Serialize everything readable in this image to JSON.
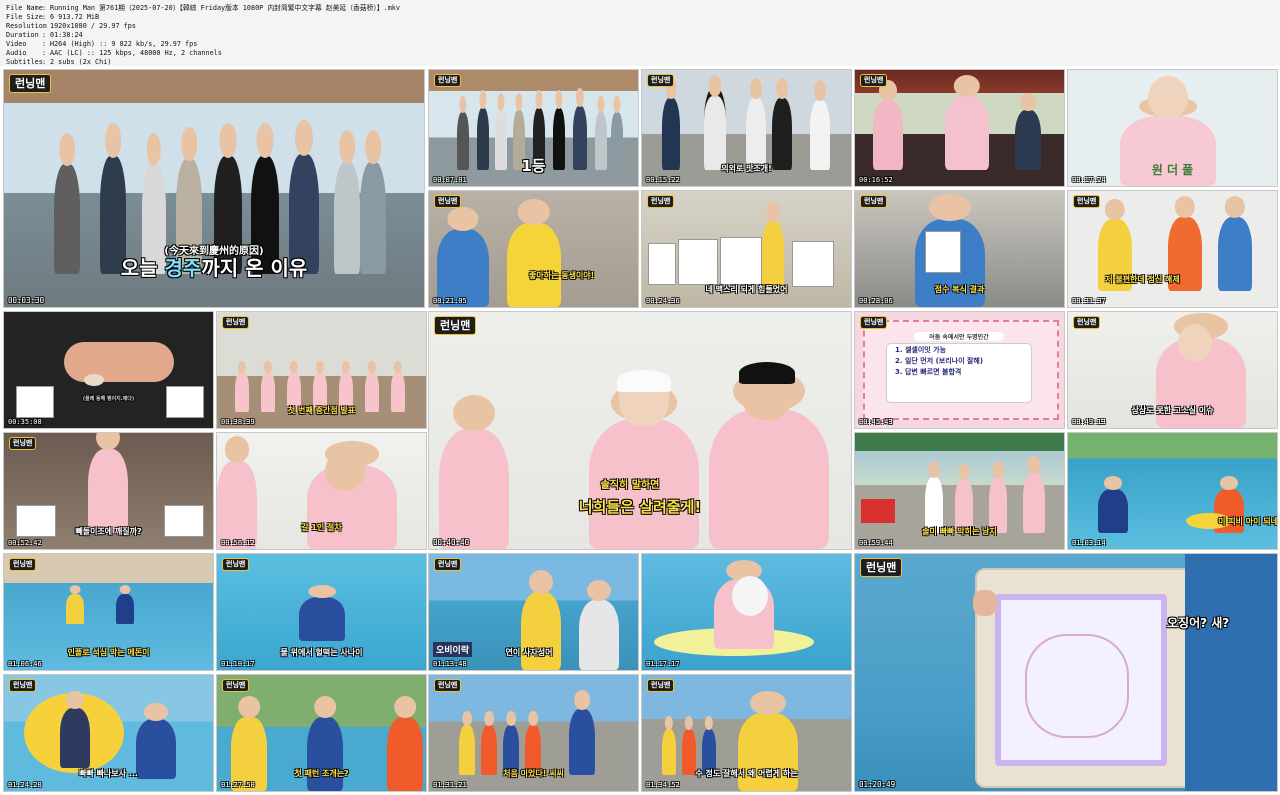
{
  "file_info": [
    {
      "key": "File Name",
      "value": "Running Man 第761期（2025-07-20）【韓綜 Friday版本 1080P 内封简繁中文字幕 赵美延（香菇桥）】.mkv"
    },
    {
      "key": "File Size",
      "value": "6 913.72 MiB"
    },
    {
      "key": "Resolution",
      "value": "1920x1080 / 29.97 fps"
    },
    {
      "key": "Duration",
      "value": "01:38:24"
    },
    {
      "key": "Video",
      "value": "H264 (High) :: 9 822 kb/s, 29.97 fps"
    },
    {
      "key": "Audio",
      "value": "AAC (LC) :: 125 kbps, 48000 Hz, 2 channels"
    },
    {
      "key": "Subtitles",
      "value": "2 subs (2x Chi)"
    }
  ],
  "info_separator": ":",
  "logo_text": "런닝맨",
  "tiles": [
    {
      "id": 1,
      "timestamp": "00:03:30",
      "caption_zh": "(今天來到慶州的原因)",
      "caption_pre": "오늘 ",
      "caption_hl": "경주",
      "caption_post": "까지 온 이유"
    },
    {
      "id": 2,
      "timestamp": "00:07:01",
      "caption": "1등"
    },
    {
      "id": 3,
      "timestamp": "00:15:22",
      "caption": "의외로 맛조개!"
    },
    {
      "id": 4,
      "timestamp": "00:16:52",
      "caption": ""
    },
    {
      "id": 5,
      "timestamp": "00:17:24",
      "caption": "원 더 풀"
    },
    {
      "id": 6,
      "timestamp": "00:21:05",
      "caption": "좋아하는 동생이야!"
    },
    {
      "id": 7,
      "timestamp": "00:24:36",
      "caption": "네 맥스리 되게 힘들었어"
    },
    {
      "id": 8,
      "timestamp": "00:28:06",
      "caption": "점수 복식 결과"
    },
    {
      "id": 9,
      "timestamp": "00:31:37",
      "caption": "저 불편한데 정신 해제"
    },
    {
      "id": 10,
      "timestamp": "00:35:08",
      "caption": "(플레 동해 팽이지.제다)"
    },
    {
      "id": 11,
      "timestamp": "00:38:39",
      "caption": "첫 번째 중간점 발표"
    },
    {
      "id": 12,
      "timestamp": "00:40:40",
      "caption_top": "솔직히 말하면",
      "caption": "너희들은 살려줄게!"
    },
    {
      "id": 13,
      "timestamp": "00:45:43",
      "panel_title": "어둠 속에서만 두명인간",
      "list": [
        "1. 셀셀이잇 가능",
        "2. 일단 먼저 (보리나이 잘해)",
        "3. 답변 빠르면 불합격"
      ]
    },
    {
      "id": 14,
      "timestamp": "00:49:13",
      "caption": "상상도 못한 고소실 이슈"
    },
    {
      "id": 15,
      "timestamp": "00:52:42",
      "caption": "빼돌이조에 깨질까?"
    },
    {
      "id": 16,
      "timestamp": "00:56:12",
      "caption": "갈 1인 절차"
    },
    {
      "id": 17,
      "timestamp": "00:59:44",
      "caption": "솔이 빠빠 막히는 남지"
    },
    {
      "id": 18,
      "timestamp": "01:03:14",
      "caption": "이 피비 아이 되네"
    },
    {
      "id": 19,
      "timestamp": "01:06:46",
      "caption": "인플로 석심 막는 에돈이"
    },
    {
      "id": 20,
      "timestamp": "01:10:17",
      "caption": "물 위에서 헐떡는 사나이"
    },
    {
      "id": 21,
      "timestamp": "01:13:48",
      "caption_top": "오비이락",
      "caption": "연이 사자성어"
    },
    {
      "id": 22,
      "timestamp": "01:17:17",
      "caption": ""
    },
    {
      "id": 23,
      "timestamp": "01:20:49",
      "bubble": "오징어? 새?"
    },
    {
      "id": 24,
      "timestamp": "01:24:20",
      "caption": "빠빠 빠나보사 ..."
    },
    {
      "id": 25,
      "timestamp": "01:27:50",
      "caption": "첫 패턴 조개는?"
    },
    {
      "id": 26,
      "timestamp": "01:31:21",
      "caption": "처음 이었다! 씨씨"
    },
    {
      "id": 27,
      "timestamp": "01:34:52",
      "caption": "수 정도 잘해서 왜 어렵게 하는"
    }
  ]
}
